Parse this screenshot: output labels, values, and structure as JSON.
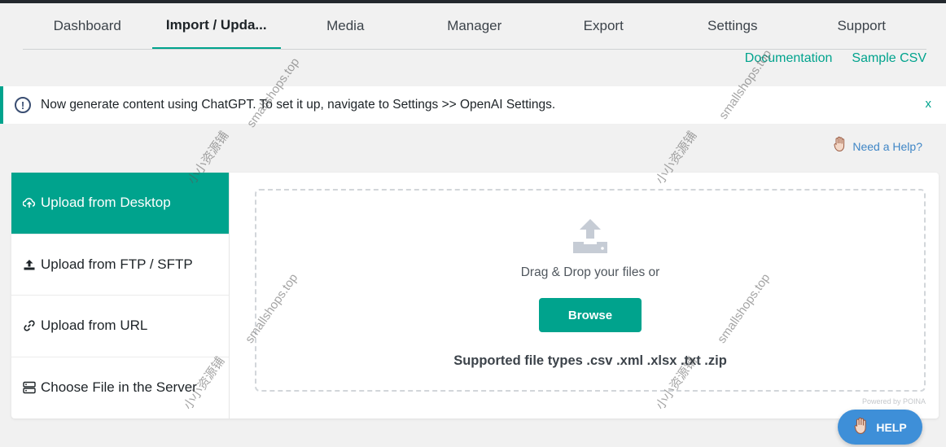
{
  "tabs": [
    {
      "label": "Dashboard",
      "active": false
    },
    {
      "label": "Import / Upda...",
      "active": true
    },
    {
      "label": "Media",
      "active": false
    },
    {
      "label": "Manager",
      "active": false
    },
    {
      "label": "Export",
      "active": false
    },
    {
      "label": "Settings",
      "active": false
    },
    {
      "label": "Support",
      "active": false
    }
  ],
  "links": {
    "documentation": "Documentation",
    "sample_csv": "Sample CSV"
  },
  "notice": {
    "text": "Now generate content using ChatGPT. To set it up, navigate to Settings >> OpenAI Settings.",
    "close": "x"
  },
  "need_help": "Need a Help?",
  "sidebar": {
    "items": [
      {
        "label": "Upload from Desktop",
        "icon": "cloud-upload-icon",
        "active": true
      },
      {
        "label": "Upload from FTP / SFTP",
        "icon": "upload-icon",
        "active": false
      },
      {
        "label": "Upload from URL",
        "icon": "link-icon",
        "active": false
      },
      {
        "label": "Choose File in the Server",
        "icon": "server-icon",
        "active": false
      }
    ]
  },
  "dropzone": {
    "drag_text": "Drag & Drop your files or",
    "browse": "Browse",
    "supported": "Supported file types .csv .xml .xlsx .txt .zip",
    "powered": "Powered by POINA"
  },
  "help_button": "HELP",
  "watermarks": [
    "smallshops.top",
    "小小资源铺"
  ],
  "colors": {
    "accent": "#00a38d",
    "help_button": "#3e8fd8",
    "topbar": "#23282d"
  }
}
